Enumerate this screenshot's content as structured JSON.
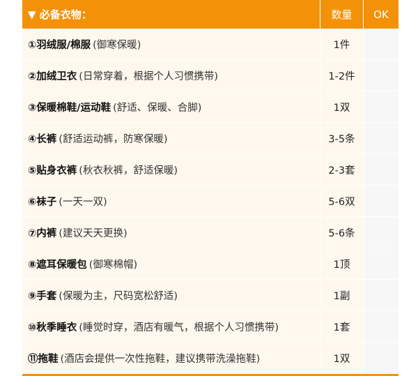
{
  "header": {
    "title": "▼ 必备衣物：",
    "qty_label": "数量",
    "ok_label": "OK"
  },
  "items": [
    {
      "name": "①羽绒服/棉服",
      "note": "(御寒保暖)",
      "qty": "1件"
    },
    {
      "name": "②加绒卫衣",
      "note": "(日常穿着，根据个人习惯携带)",
      "qty": "1-2件"
    },
    {
      "name": "③保暖棉鞋/运动鞋",
      "note": "(舒适、保暖、合脚)",
      "qty": "1双"
    },
    {
      "name": "④长裤",
      "note": "(舒适运动裤，防寒保暖)",
      "qty": "3-5条"
    },
    {
      "name": "⑤贴身衣裤",
      "note": "(秋衣秋裤，舒适保暖)",
      "qty": "2-3套"
    },
    {
      "name": "⑥袜子",
      "note": "(一天一双)",
      "qty": "5-6双"
    },
    {
      "name": "⑦内裤",
      "note": "(建议天天更换)",
      "qty": "5-6条"
    },
    {
      "name": "⑧遮耳保暖包",
      "note": "(御寒棉帽)",
      "qty": "1顶"
    },
    {
      "name": "⑨手套",
      "note": "(保暖为主，尺码宽松舒适)",
      "qty": "1副"
    },
    {
      "name": "⑩秋季睡衣",
      "note": "(睡觉时穿，酒店有暖气，根据个人习惯携带)",
      "qty": "1套"
    },
    {
      "name": "⑪拖鞋",
      "note": "(酒店会提供一次性拖鞋，建议携带洗澡拖鞋)",
      "qty": "1双"
    }
  ],
  "colors": {
    "accent": "#f39208",
    "row_bg": "#fef8ee",
    "ok_bg": "#f7f7f7"
  }
}
